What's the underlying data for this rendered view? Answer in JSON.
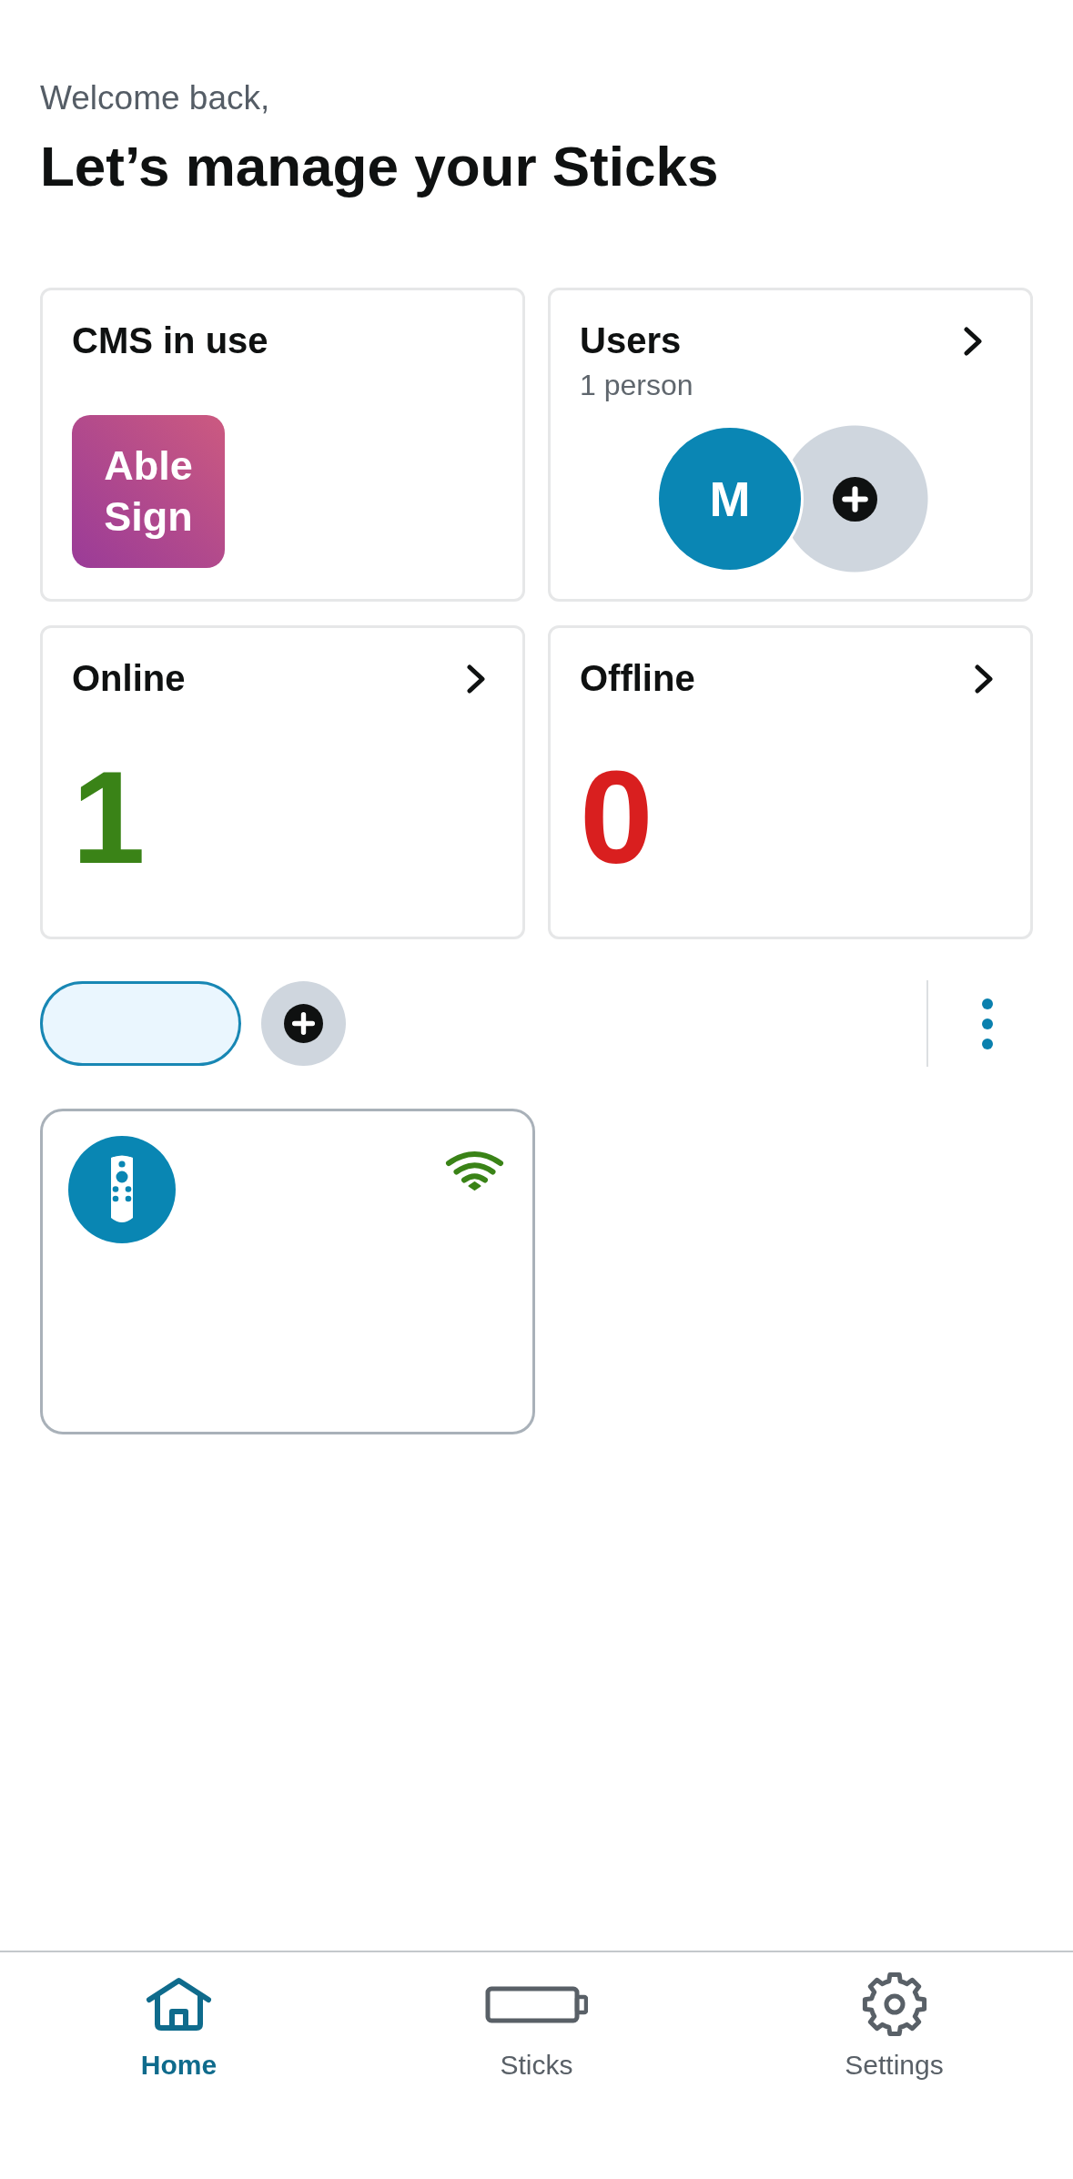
{
  "header": {
    "greeting": "Welcome back,",
    "title": "Let’s manage your Sticks"
  },
  "cards": [
    {
      "kind": "cms",
      "title": "CMS in use",
      "logo_text": "Able Sign"
    },
    {
      "kind": "users",
      "title": "Users",
      "subtitle": "1 person",
      "avatars": [
        {
          "initial": "M"
        }
      ]
    },
    {
      "kind": "count",
      "title": "Online",
      "value": "1",
      "color": "#3a8317"
    },
    {
      "kind": "count",
      "title": "Offline",
      "value": "0",
      "color": "#d91f1f"
    }
  ],
  "groups": {
    "chips": [
      {
        "selected": true
      }
    ]
  },
  "devices": [
    {
      "online": true
    }
  ],
  "nav": [
    {
      "kind": "home",
      "label": "Home",
      "selected": true
    },
    {
      "kind": "sticks",
      "label": "Sticks",
      "selected": false
    },
    {
      "kind": "settings",
      "label": "Settings",
      "selected": false
    }
  ]
}
